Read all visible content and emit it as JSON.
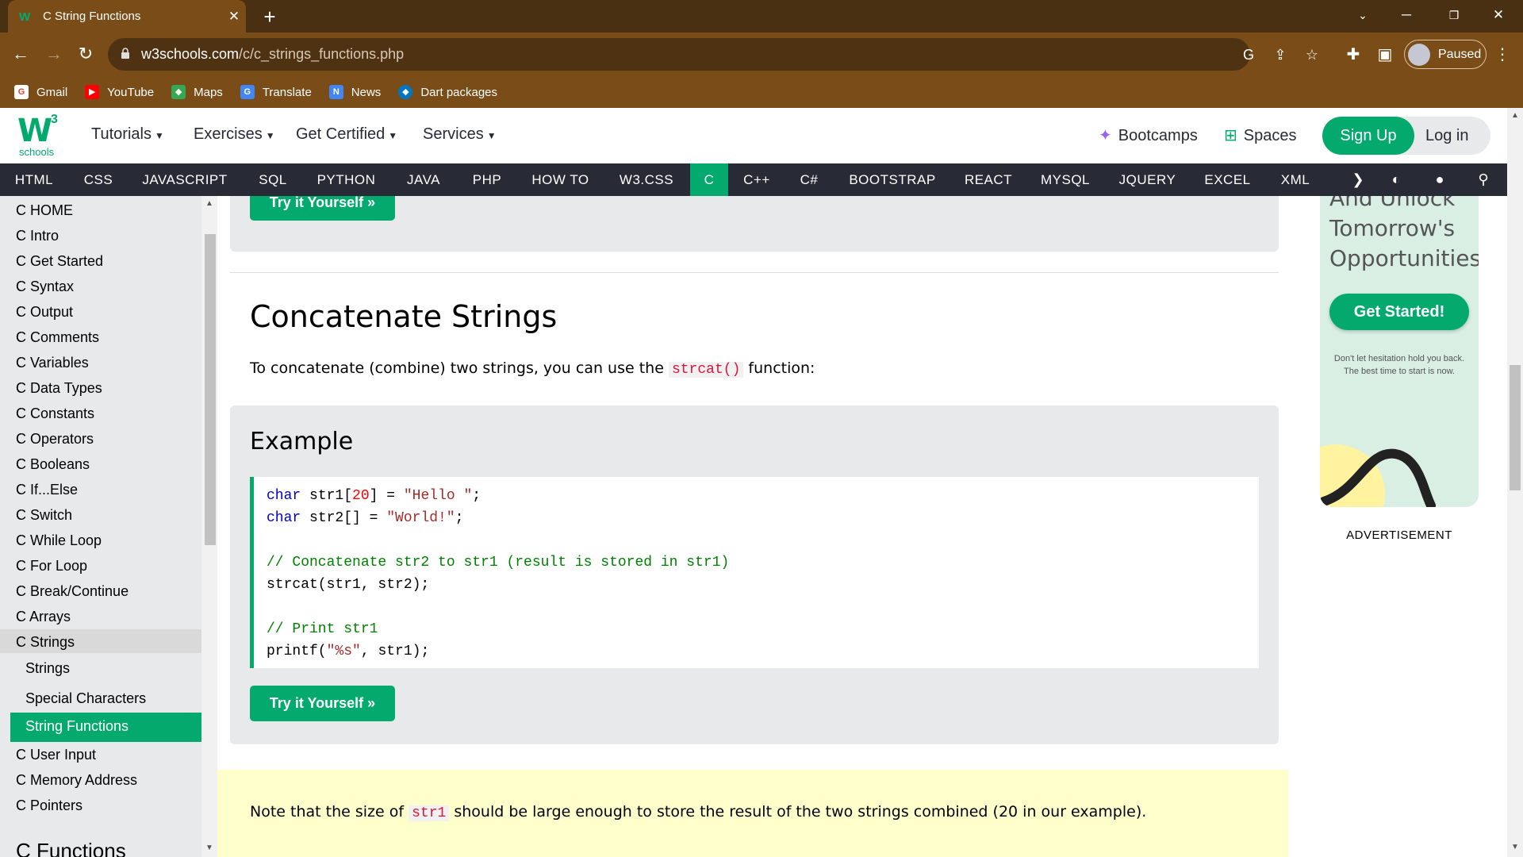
{
  "browser": {
    "tab_title": "C String Functions",
    "url_host": "w3schools.com",
    "url_path": "/c/c_strings_functions.php",
    "profile_label": "Paused",
    "bookmarks": [
      "Gmail",
      "YouTube",
      "Maps",
      "Translate",
      "News",
      "Dart packages"
    ]
  },
  "header": {
    "logo_super": "3",
    "logo_text": "schools",
    "nav": [
      "Tutorials",
      "Exercises",
      "Get Certified",
      "Services"
    ],
    "bootcamps": "Bootcamps",
    "spaces": "Spaces",
    "signup": "Sign Up",
    "login": "Log in"
  },
  "subnav": {
    "items": [
      "HTML",
      "CSS",
      "JAVASCRIPT",
      "SQL",
      "PYTHON",
      "JAVA",
      "PHP",
      "HOW TO",
      "W3.CSS",
      "C",
      "C++",
      "C#",
      "BOOTSTRAP",
      "REACT",
      "MYSQL",
      "JQUERY",
      "EXCEL",
      "XML"
    ],
    "active": "C"
  },
  "sidebar": {
    "items": [
      "C HOME",
      "C Intro",
      "C Get Started",
      "C Syntax",
      "C Output",
      "C Comments",
      "C Variables",
      "C Data Types",
      "C Constants",
      "C Operators",
      "C Booleans",
      "C If...Else",
      "C Switch",
      "C While Loop",
      "C For Loop",
      "C Break/Continue",
      "C Arrays",
      "C Strings"
    ],
    "sub_items": [
      "Strings",
      "Special Characters",
      "String Functions"
    ],
    "after_items": [
      "C User Input",
      "C Memory Address",
      "C Pointers"
    ],
    "section_heading": "C Functions"
  },
  "main": {
    "try_label": "Try it Yourself »",
    "heading": "Concatenate Strings",
    "intro_before": "To concatenate (combine) two strings, you can use the ",
    "intro_code": "strcat()",
    "intro_after": " function:",
    "example_title": "Example",
    "note_before": "Note that the size of ",
    "note_code": "str1",
    "note_after": " should be large enough to store the result of the two strings combined (20 in our example)."
  },
  "ad": {
    "lines": [
      "And Unlock",
      "Tomorrow's",
      "Opportunities!"
    ],
    "button": "Get Started!",
    "small1": "Don't let hesitation hold you back.",
    "small2": "The best time to start is now.",
    "label": "ADVERTISEMENT"
  },
  "colors": {
    "accent": "#04aa6d",
    "chrome": "#7a4d18",
    "subnav": "#282a35"
  }
}
